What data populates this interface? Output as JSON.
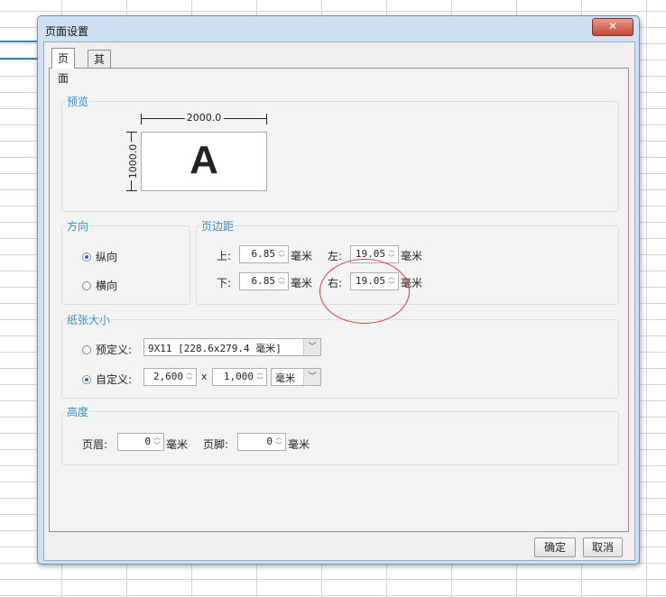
{
  "dialog": {
    "title": "页面设置",
    "close_label": "✕"
  },
  "tabs": [
    {
      "label": "页面",
      "active": true
    },
    {
      "label": "其他",
      "active": false
    }
  ],
  "preview": {
    "group_label": "预览",
    "width_label": "2000.0",
    "height_label": "1000.0",
    "letter": "A"
  },
  "orientation": {
    "group_label": "方向",
    "portrait": "纵向",
    "landscape": "横向",
    "selected": "portrait"
  },
  "margins": {
    "group_label": "页边距",
    "top_label": "上:",
    "top_value": "6.85",
    "bottom_label": "下:",
    "bottom_value": "6.85",
    "left_label": "左:",
    "left_value": "19.05",
    "right_label": "右:",
    "right_value": "19.05",
    "unit": "毫米"
  },
  "paper": {
    "group_label": "纸张大小",
    "preset_label": "预定义:",
    "preset_value": "9X11 [228.6x279.4 毫米]",
    "custom_label": "自定义:",
    "custom_width": "2,600",
    "times": "x",
    "custom_height": "1,000",
    "unit": "毫米",
    "selected": "custom"
  },
  "height": {
    "group_label": "高度",
    "header_label": "页眉:",
    "header_value": "0",
    "footer_label": "页脚:",
    "footer_value": "0",
    "unit": "毫米"
  },
  "buttons": {
    "ok": "确定",
    "cancel": "取消"
  },
  "colors": {
    "group_title": "#3a8fc9",
    "annotation_circle": "#e03a3a",
    "close_button": "#c34a32"
  }
}
